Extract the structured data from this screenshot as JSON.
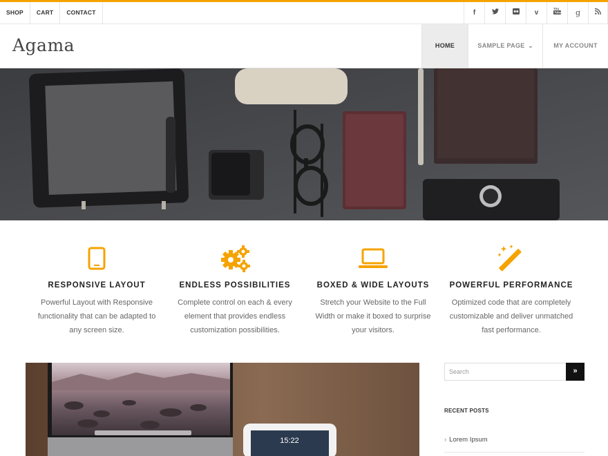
{
  "topbar": {
    "links": [
      "SHOP",
      "CART",
      "CONTACT"
    ],
    "social_icons": [
      "facebook-icon",
      "twitter-icon",
      "flickr-icon",
      "vimeo-icon",
      "youtube-icon",
      "google-plus-icon",
      "rss-icon"
    ],
    "accent_color": "#f5a300"
  },
  "header": {
    "logo": "Agama",
    "nav": {
      "home": "HOME",
      "sample": "SAMPLE PAGE",
      "account": "MY ACCOUNT"
    }
  },
  "features": [
    {
      "icon": "tablet-icon",
      "title": "RESPONSIVE LAYOUT",
      "text": "Powerful Layout with Responsive functionality that can be adapted to any screen size."
    },
    {
      "icon": "gears-icon",
      "title": "ENDLESS POSSIBILITIES",
      "text": "Complete control on each & every element that provides endless customization possibilities."
    },
    {
      "icon": "laptop-icon",
      "title": "BOXED & WIDE LAYOUTS",
      "text": "Stretch your Website to the Full Width or make it boxed to surprise your visitors."
    },
    {
      "icon": "magic-wand-icon",
      "title": "POWERFUL PERFORMANCE",
      "text": "Optimized code that are completely customizable and deliver unmatched fast performance."
    }
  ],
  "sidebar": {
    "search_placeholder": "Search",
    "search_button": "»",
    "recent_title": "RECENT POSTS",
    "recent_posts": [
      "Lorem Ipsum"
    ]
  },
  "post_image": {
    "clock_text": "15:22"
  }
}
